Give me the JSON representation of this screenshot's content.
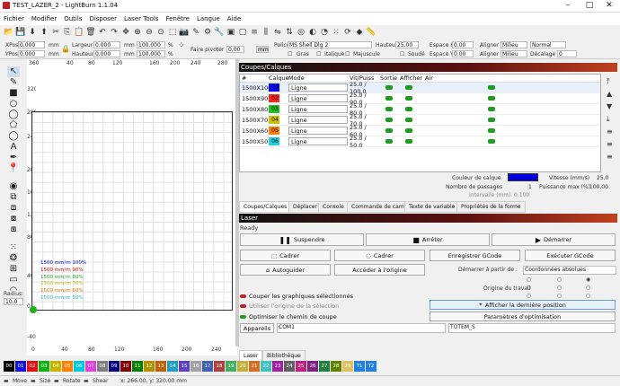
{
  "app": {
    "title": "TEST_LAZER_2 - LightBurn 1.1.04"
  },
  "menu": [
    "Fichier",
    "Modifier",
    "Outils",
    "Disposer",
    "Laser Tools",
    "Fenêtre",
    "Langue",
    "Aide"
  ],
  "toolbar2": {
    "xpos_label": "XPos",
    "xpos": "0.000",
    "ypos_label": "YPos",
    "ypos": "0.000",
    "unit": "mm",
    "largeur_label": "Largeur",
    "largeur": "0.000",
    "hauteur_label": "Hauteur",
    "hauteur": "0.000",
    "pct1": "100.000",
    "pct2": "100.000",
    "pct_sym": "%",
    "rot_label": "Faire pivoter",
    "rot": "0,00",
    "rot_unit": "mm",
    "police_label": "Police",
    "police": "MS Shell Dlg 2",
    "hauteur_font_label": "Hauteur",
    "hauteur_font": "25.00",
    "espace_h_label": "Espace H",
    "espace_h": "0.00",
    "espace_v_label": "Espace V",
    "espace_v": "0.00",
    "aligner_x_label": "Aligner X",
    "aligner_x": "Milieu",
    "aligner_y_label": "Aligner Y",
    "aligner_y": "Milieu",
    "normal": "Normal",
    "decalage_label": "Décalage",
    "decalage": "0",
    "gras": "Gras",
    "italique": "Italique",
    "majuscule": "Majuscule",
    "soude": "Soudé"
  },
  "rulers": {
    "top": [
      "360",
      "0",
      "40",
      "80",
      "120",
      "160",
      "200",
      "240",
      "280"
    ],
    "left": [
      "360",
      "320",
      "280",
      "240",
      "200",
      "160",
      "120",
      "80",
      "40",
      "0",
      "-40"
    ],
    "bottom": [
      "0",
      "40",
      "80",
      "120",
      "160",
      "200",
      "240"
    ]
  },
  "canvas_speeds": [
    {
      "text": "1500 mm/m 100%",
      "color": "#0000cc"
    },
    {
      "text": "1500 mm/m 90%",
      "color": "#cc0000"
    },
    {
      "text": "1500 mm/m 80%",
      "color": "#2aa02a"
    },
    {
      "text": "1500 mm/m 70%",
      "color": "#b5b500"
    },
    {
      "text": "1500 mm/m 60%",
      "color": "#e07000"
    },
    {
      "text": "1500 mm/m 50%",
      "color": "#20b8c8"
    }
  ],
  "radius": {
    "label": "Radius:",
    "value": "10.0"
  },
  "layers": {
    "title": "Coupes/Calques",
    "headers": [
      "#",
      "Calque",
      "Mode",
      "Vit/Puiss",
      "Sortie",
      "Afficher",
      "Air"
    ],
    "rows": [
      {
        "name": "1500X100",
        "num": "00",
        "color": "#0000ff",
        "mode": "Ligne",
        "vp": "25.0 / 100.0"
      },
      {
        "name": "1500X90",
        "num": "02",
        "color": "#ff2020",
        "mode": "Ligne",
        "vp": "25.0 / 90.0"
      },
      {
        "name": "1500X80",
        "num": "03",
        "color": "#20c020",
        "mode": "Ligne",
        "vp": "25.0 / 80.0"
      },
      {
        "name": "1500X70",
        "num": "04",
        "color": "#d0c000",
        "mode": "Ligne",
        "vp": "25.0 / 70.0"
      },
      {
        "name": "1500X60",
        "num": "05",
        "color": "#ff8000",
        "mode": "Ligne",
        "vp": "25.0 / 60.0"
      },
      {
        "name": "1500X50",
        "num": "06",
        "color": "#20d0e0",
        "mode": "Ligne",
        "vp": "25.0 / 50.0"
      }
    ],
    "couleur_label": "Couleur de calque",
    "vitesse_label": "Vitesse (mm/s)",
    "vitesse": "25,0",
    "passes_label": "Nombre de passages",
    "passes": "1",
    "puissance_label": "Puissance max (%)",
    "puissance": "100,00",
    "intervalle_label": "Intervalle (mm)",
    "intervalle": "0.100"
  },
  "tabs1": [
    "Coupes/Calques",
    "Déplacer",
    "Console",
    "Commande de caméra",
    "Texte de variable",
    "Propriétés de la forme"
  ],
  "laser": {
    "title": "Laser",
    "status": "Ready",
    "suspendre": "Suspendre",
    "arreter": "Arrêter",
    "demarrer": "Démarrer",
    "cadrer1": "Cadrer",
    "cadrer2": "Cadrer",
    "enregistrer": "Enregistrer GCode",
    "executer": "Exécuter GCode",
    "autoguider": "Autoguider",
    "acceder": "Accéder à l'origine",
    "demarrer_a_label": "Démarrer à partir de :",
    "demarrer_a": "Coordonnées absolues",
    "origine_label": "Origine du travail",
    "couper": "Couper les graphiques sélectionnés",
    "utiliser": "Utiliser l'origine de la sélection",
    "optimiser": "Optimiser le chemin de coupe",
    "afficher_pos": "Afficher la dernière position",
    "params": "Paramètres d'optimisation",
    "appareils": "Appareils",
    "com": "COM1",
    "device": "TOTEM_S"
  },
  "tabs2": [
    "Laser",
    "Bibliothèque"
  ],
  "palette": [
    {
      "n": "00",
      "c": "#000000"
    },
    {
      "n": "01",
      "c": "#1010e0"
    },
    {
      "n": "02",
      "c": "#e01010"
    },
    {
      "n": "03",
      "c": "#10b010"
    },
    {
      "n": "04",
      "c": "#c8b400"
    },
    {
      "n": "05",
      "c": "#ff8000"
    },
    {
      "n": "06",
      "c": "#00c8e0"
    },
    {
      "n": "07",
      "c": "#e040e0"
    },
    {
      "n": "08",
      "c": "#808080"
    },
    {
      "n": "09",
      "c": "#000080"
    },
    {
      "n": "10",
      "c": "#800000"
    },
    {
      "n": "11",
      "c": "#008000"
    },
    {
      "n": "12",
      "c": "#b09000"
    },
    {
      "n": "13",
      "c": "#c06000"
    },
    {
      "n": "14",
      "c": "#20a0c0"
    },
    {
      "n": "15",
      "c": "#6040c0"
    },
    {
      "n": "16",
      "c": "#a0a0a0"
    },
    {
      "n": "17",
      "c": "#4060b0"
    },
    {
      "n": "18",
      "c": "#b04040"
    },
    {
      "n": "19",
      "c": "#40b060"
    },
    {
      "n": "20",
      "c": "#c0b040"
    },
    {
      "n": "21",
      "c": "#d07020"
    },
    {
      "n": "22",
      "c": "#40c0c0"
    },
    {
      "n": "23",
      "c": "#a020a0"
    },
    {
      "n": "24",
      "c": "#606060"
    },
    {
      "n": "25",
      "c": "#c02080"
    },
    {
      "n": "26",
      "c": "#802080"
    },
    {
      "n": "27",
      "c": "#208040"
    },
    {
      "n": "28",
      "c": "#608000"
    },
    {
      "n": "29",
      "c": "#e0c060"
    },
    {
      "n": "T1",
      "c": "#2080e0"
    },
    {
      "n": "T2",
      "c": "#2080e0"
    }
  ],
  "status": {
    "move": "Move",
    "size": "Size",
    "rotate": "Rotate",
    "shear": "Shear",
    "coords": "x: 266.00, y: 320.00 mm"
  }
}
